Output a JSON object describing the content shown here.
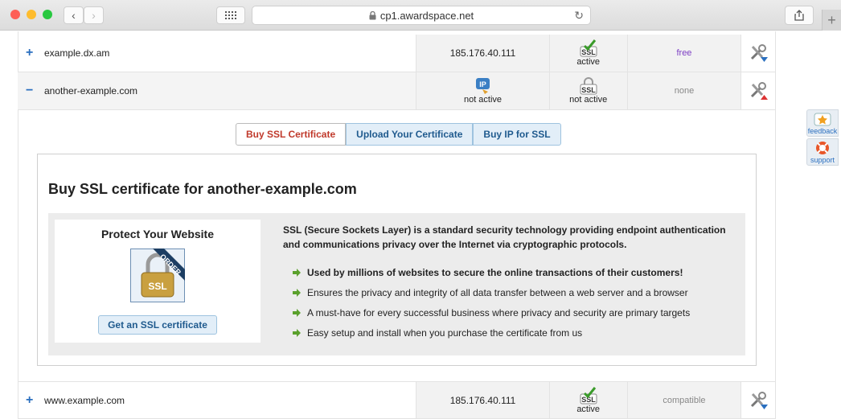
{
  "browser": {
    "url": "cp1.awardspace.net"
  },
  "domains": [
    {
      "name": "example.dx.am",
      "toggle": "+",
      "ip": "185.176.40.111",
      "ssl_status": "active",
      "plan": "free",
      "plan_color": "#7d3fc4"
    },
    {
      "name": "another-example.com",
      "toggle": "−",
      "ip_status": "not active",
      "ssl_status": "not active",
      "plan": "none",
      "plan_color": "#888888"
    },
    {
      "name": "www.example.com",
      "toggle": "+",
      "ip": "185.176.40.111",
      "ssl_status": "active",
      "plan": "compatible",
      "plan_color": "#888888"
    }
  ],
  "icons": {
    "ip_badge": "IP",
    "ssl_badge": "SSL"
  },
  "tabs": [
    "Buy SSL Certificate",
    "Upload Your Certificate",
    "Buy IP for SSL"
  ],
  "panel": {
    "title": "Buy SSL certificate for another-example.com",
    "card_title": "Protect Your Website",
    "card_image_text": "SSL",
    "card_ribbon": "ORDER",
    "card_button": "Get an SSL certificate",
    "description": "SSL (Secure Sockets Layer) is a standard security technology providing endpoint authentication and communications privacy over the Internet via cryptographic protocols.",
    "bullets": [
      "Used by millions of websites to secure the online transactions of their customers!",
      "Ensures the privacy and integrity of all data transfer between a web server and a browser",
      "A must-have for every successful business where privacy and security are primary targets",
      "Easy setup and install when you purchase the certificate from us"
    ]
  },
  "side_widgets": {
    "feedback": "feedback",
    "support": "support"
  }
}
